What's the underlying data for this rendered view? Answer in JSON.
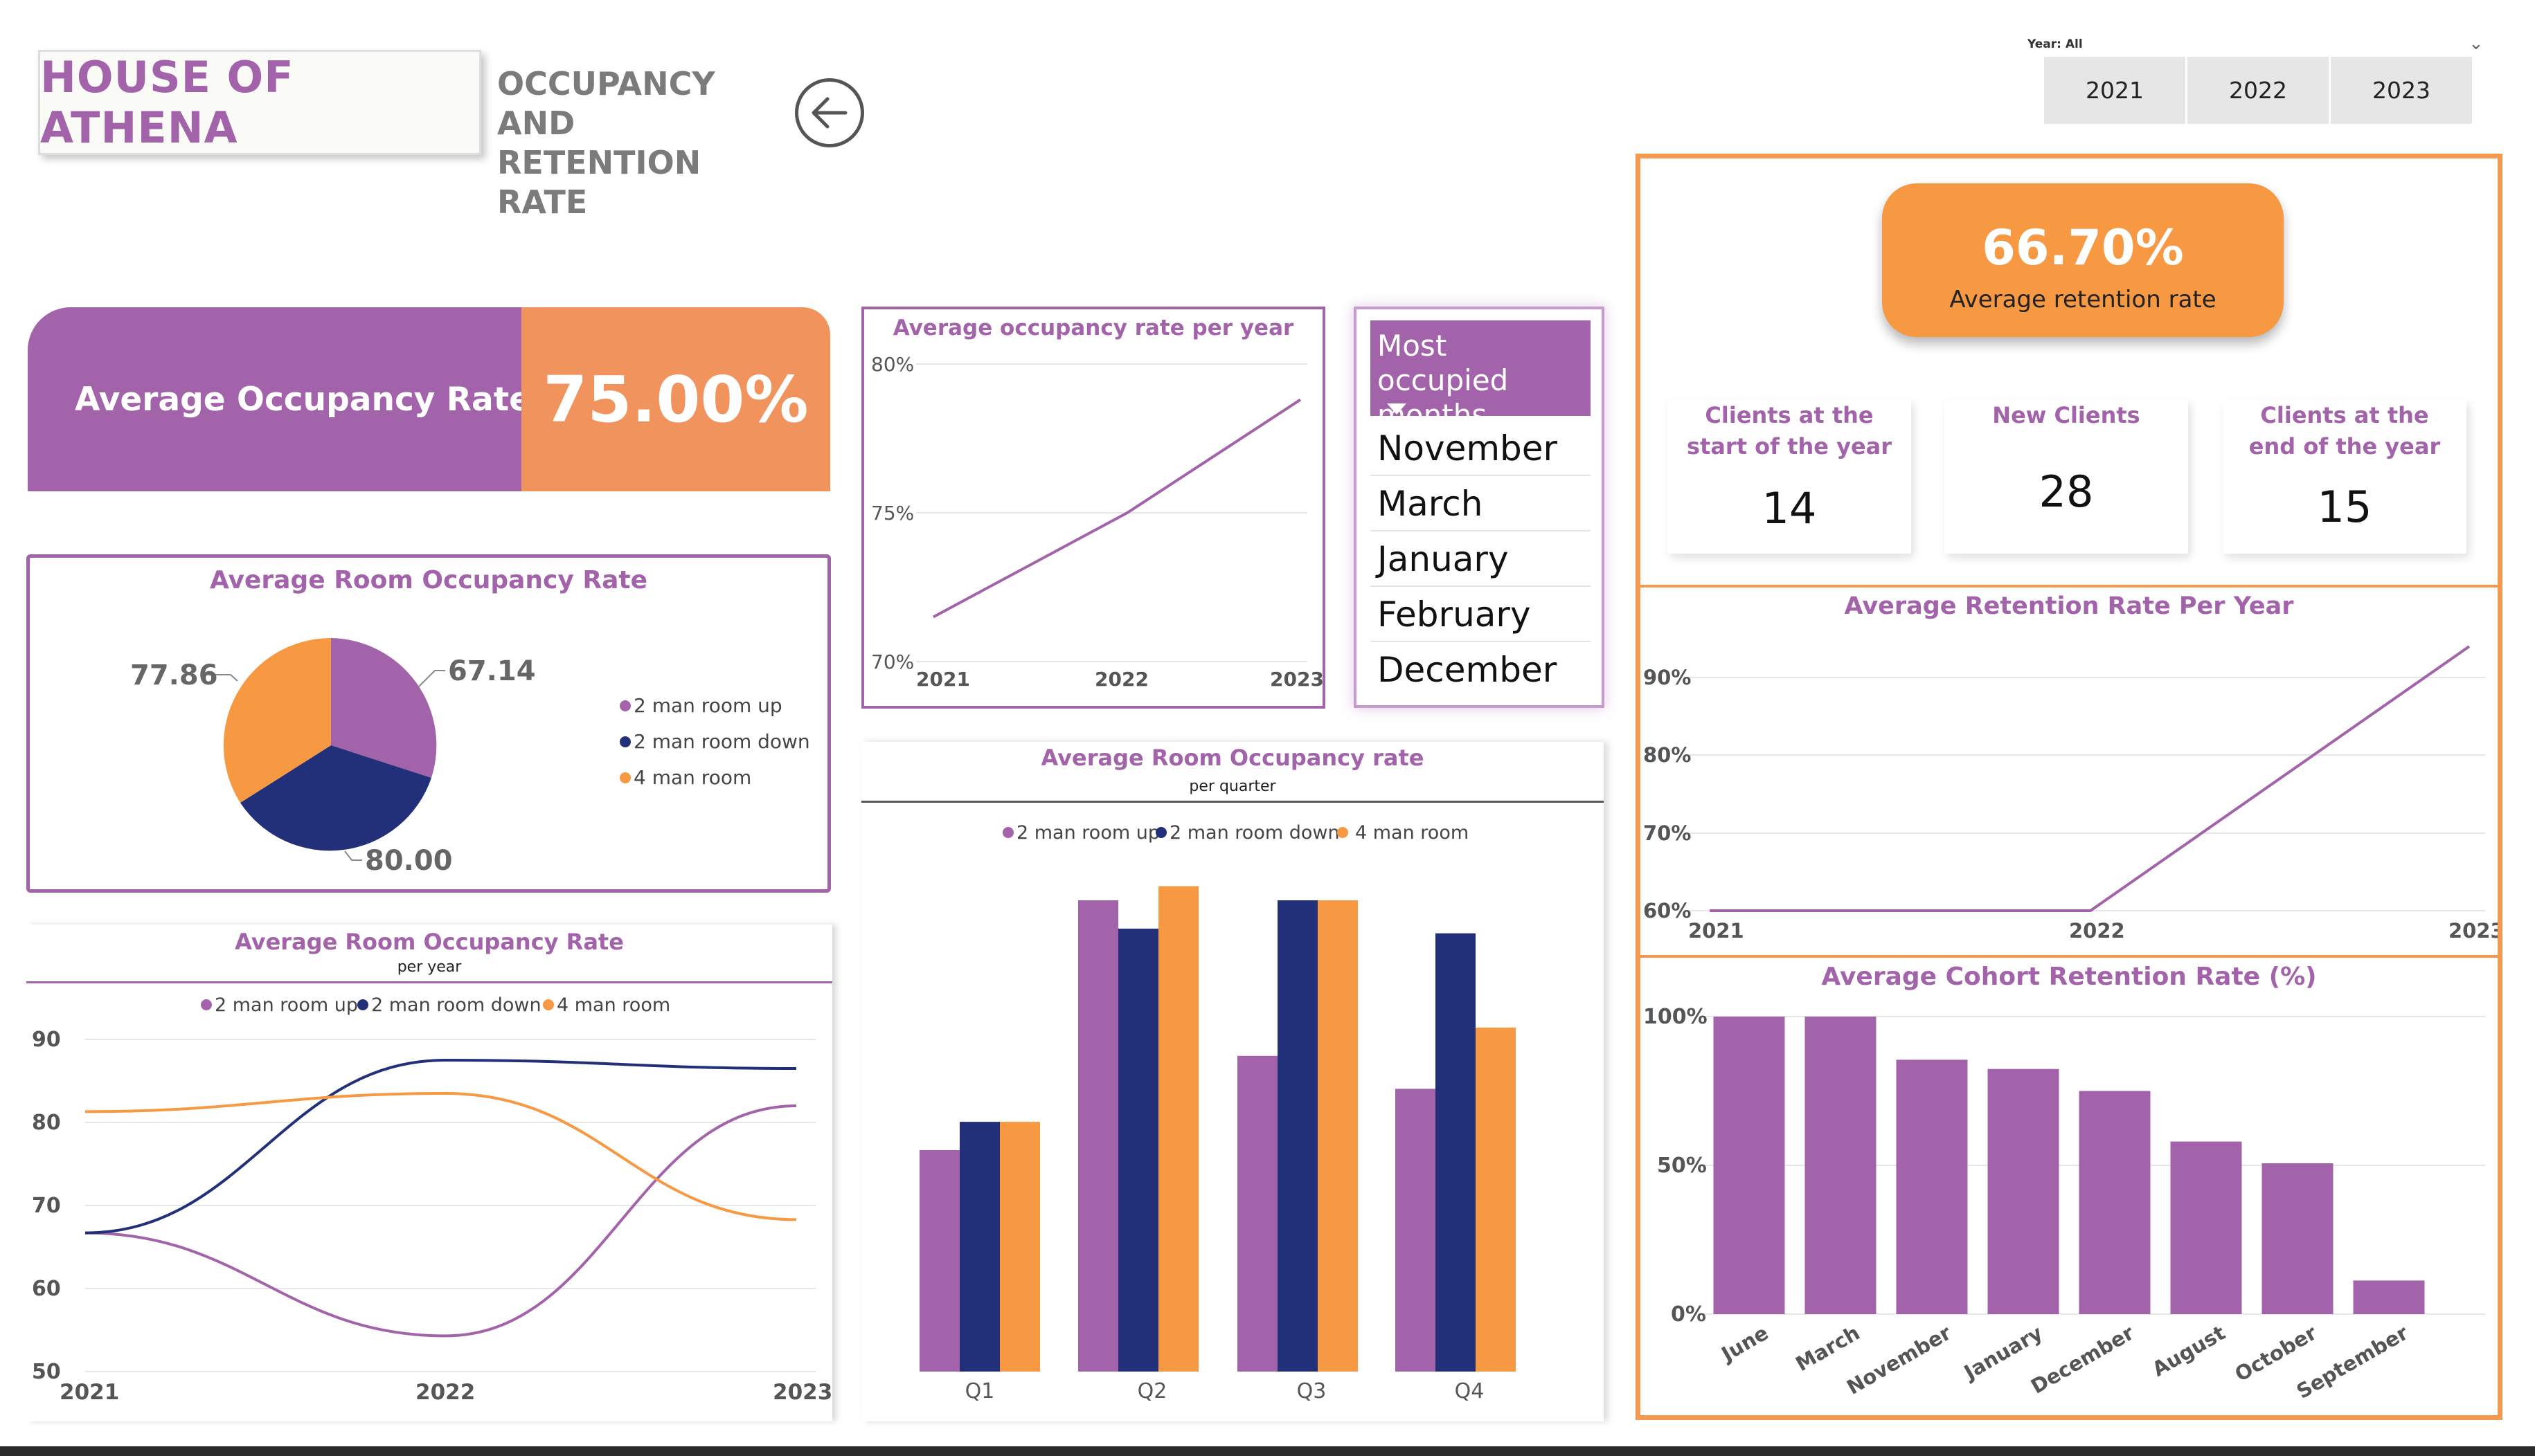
{
  "header": {
    "brand": "HOUSE OF ATHENA",
    "title_line1": "OCCUPANCY AND",
    "title_line2": "RETENTION RATE",
    "back_icon": "arrow-left-icon"
  },
  "year_slicer": {
    "label": "Year: All",
    "options": [
      "2021",
      "2022",
      "2023"
    ]
  },
  "kpi": {
    "occupancy_label": "Average Occupancy Rate",
    "occupancy_value": "75.00%",
    "retention_value": "66.70%",
    "retention_label": "Average retention rate"
  },
  "clients": {
    "start_label": "Clients at the start of the year",
    "start_value": "14",
    "new_label": "New Clients",
    "new_value": "28",
    "end_label": "Clients at the end of the year",
    "end_value": "15"
  },
  "months_table": {
    "header": "Most occupied months",
    "rows": [
      "November",
      "March",
      "January",
      "February",
      "December"
    ]
  },
  "colors": {
    "purple": "#a363aa",
    "navy": "#22307a",
    "orange": "#f79843",
    "kpi_orange": "#f0935d"
  },
  "chart_data": [
    {
      "id": "room_pie",
      "type": "pie",
      "title": "Average Room Occupancy Rate",
      "categories": [
        "2 man room up",
        "2 man room down",
        "4 man room"
      ],
      "values": [
        67.14,
        80.0,
        77.86
      ],
      "labels": [
        "67.14",
        "80.00",
        "77.86"
      ],
      "legend": "right"
    },
    {
      "id": "occ_year",
      "type": "line",
      "title": "Average occupancy rate per year",
      "x": [
        "2021",
        "2022",
        "2023"
      ],
      "series": [
        {
          "values": [
            71.5,
            75.0,
            78.8
          ]
        }
      ],
      "yticks": [
        "70%",
        "75%",
        "80%"
      ],
      "ylim": [
        70,
        80
      ]
    },
    {
      "id": "room_year",
      "type": "line",
      "title": "Average Room Occupancy Rate",
      "subtitle": "per year",
      "x": [
        "2021",
        "2022",
        "2023"
      ],
      "series": [
        {
          "name": "2 man room up",
          "values": [
            66.7,
            54.3,
            82.0
          ]
        },
        {
          "name": "2 man room down",
          "values": [
            66.7,
            87.5,
            86.5
          ]
        },
        {
          "name": "4 man room",
          "values": [
            81.3,
            83.5,
            68.3
          ]
        }
      ],
      "yticks": [
        "50",
        "60",
        "70",
        "80",
        "90"
      ],
      "ylim": [
        50,
        90
      ],
      "legend": "top"
    },
    {
      "id": "room_quarter",
      "type": "bar",
      "title": "Average Room Occupancy rate",
      "subtitle": "per quarter",
      "categories": [
        "Q1",
        "Q2",
        "Q3",
        "Q4"
      ],
      "series": [
        {
          "name": "2 man room up",
          "values": [
            47,
            100,
            67,
            60
          ]
        },
        {
          "name": "2 man room down",
          "values": [
            53,
            94,
            100,
            93
          ]
        },
        {
          "name": "4 man room",
          "values": [
            53,
            103,
            100,
            73
          ]
        }
      ],
      "ylim": [
        0,
        105
      ],
      "legend": "top"
    },
    {
      "id": "retention_year",
      "type": "line",
      "title": "Average Retention Rate Per Year",
      "x": [
        "2021",
        "2022",
        "2023"
      ],
      "series": [
        {
          "values": [
            60.0,
            60.0,
            94.0
          ]
        }
      ],
      "yticks": [
        "60%",
        "70%",
        "80%",
        "90%"
      ],
      "ylim": [
        60,
        95
      ]
    },
    {
      "id": "cohort",
      "type": "bar",
      "title": "Average Cohort Retention Rate (%)",
      "categories": [
        "June",
        "March",
        "November",
        "January",
        "December",
        "August",
        "October",
        "September"
      ],
      "values": [
        100,
        100,
        85.5,
        82.4,
        75.0,
        58.0,
        50.7,
        11.3
      ],
      "yticks": [
        "0%",
        "50%",
        "100%"
      ],
      "ylim": [
        0,
        100
      ]
    }
  ]
}
